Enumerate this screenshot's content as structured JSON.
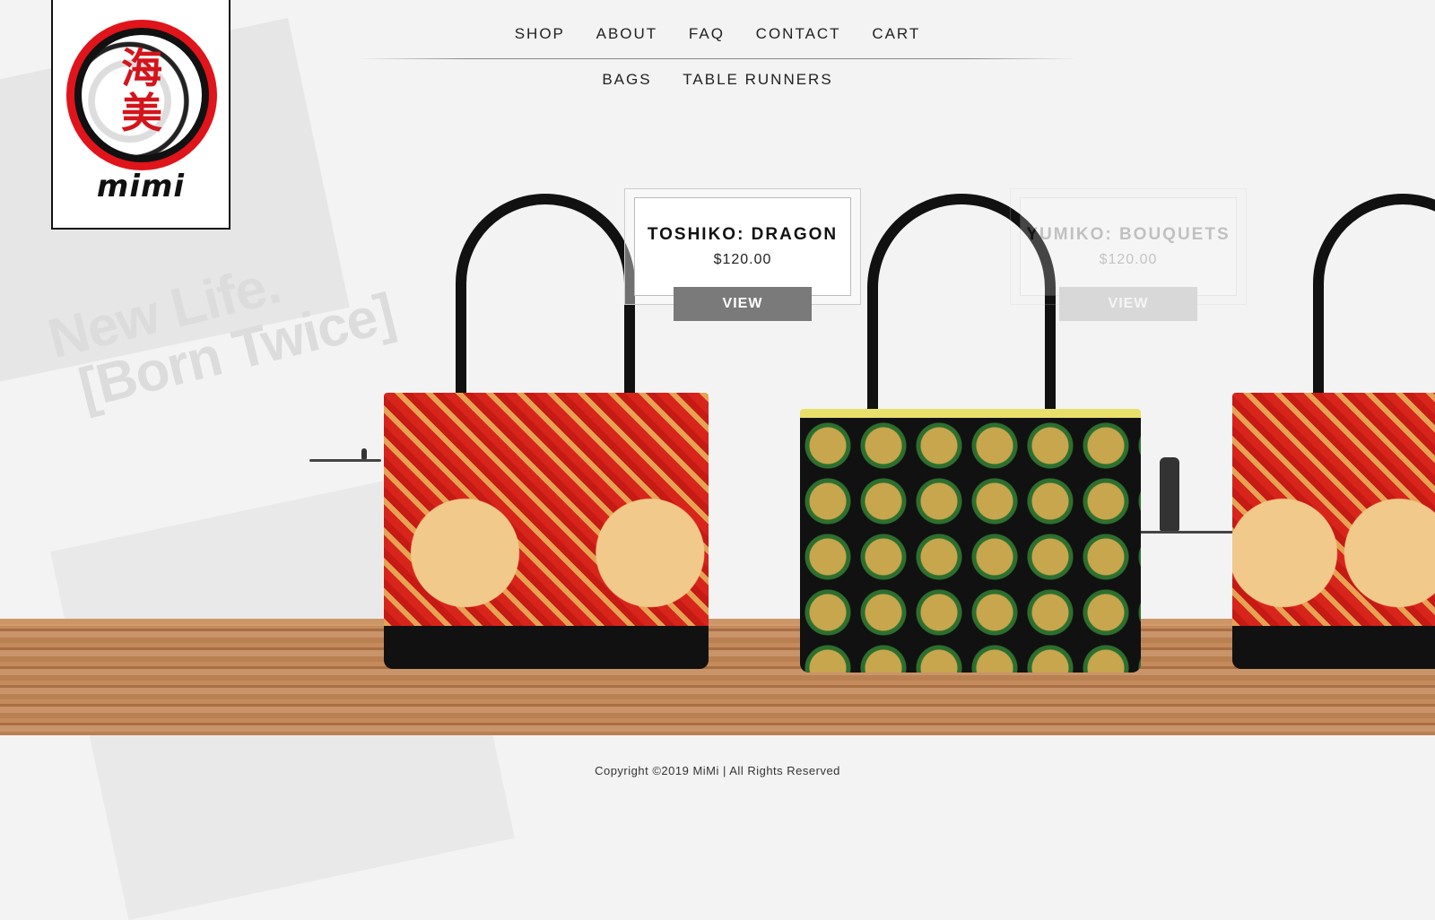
{
  "logo": {
    "kanji": "海美",
    "wordmark": "mimi",
    "colors": {
      "ring": "#e0141b",
      "text": "#111111"
    }
  },
  "tagline": {
    "line1": "New Life.",
    "line2": "[Born Twice]"
  },
  "nav": {
    "primary": [
      "SHOP",
      "ABOUT",
      "FAQ",
      "CONTACT",
      "CART"
    ],
    "secondary": [
      "BAGS",
      "TABLE RUNNERS"
    ]
  },
  "products": [
    {
      "name": "TOSHIKO: DRAGON",
      "price": "$120.00",
      "button": "VIEW",
      "state": "active"
    },
    {
      "name": "YUMIKO: BOUQUETS",
      "price": "$120.00",
      "button": "VIEW",
      "state": "faded"
    }
  ],
  "footer": {
    "copyright": "Copyright ©2019 MiMi | All Rights Reserved"
  }
}
